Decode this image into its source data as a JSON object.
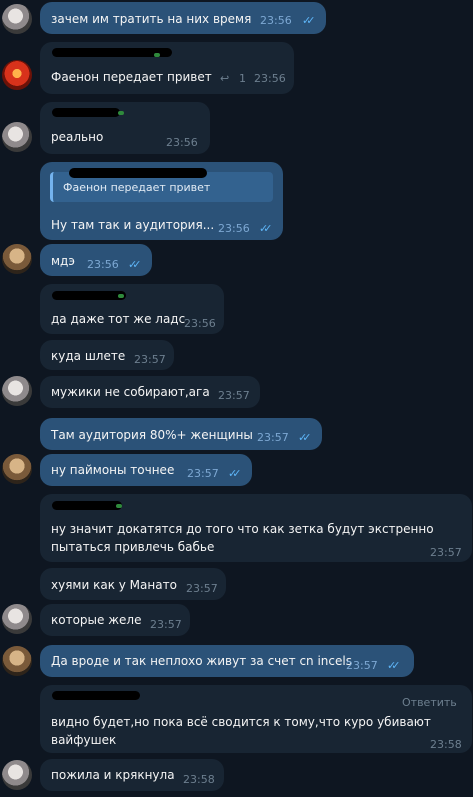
{
  "messages": [
    {
      "text": "зачем им тратить на них время",
      "time": "23:56"
    },
    {
      "text": "Фаенон передает привет",
      "time": "23:56",
      "reply_count": "1"
    },
    {
      "text": "реально",
      "time": "23:56"
    },
    {
      "reply_quote": "Фаенон передает привет",
      "text": "Ну там так и аудитория...",
      "time": "23:56"
    },
    {
      "text": "мдэ",
      "time": "23:56"
    },
    {
      "text": "да даже тот же ладс",
      "time": "23:56"
    },
    {
      "text": "куда шлете",
      "time": "23:57"
    },
    {
      "text": "мужики не собирают,ага",
      "time": "23:57"
    },
    {
      "text": "Там аудитория 80%+ женщины",
      "time": "23:57"
    },
    {
      "text": "ну паймоны точнее",
      "time": "23:57"
    },
    {
      "text_line1": "ну значит докатятся до того что как зетка будут экстренно",
      "text_line2": "пытаться привлечь бабье",
      "time": "23:57"
    },
    {
      "text": "хуями как у Манато",
      "time": "23:57"
    },
    {
      "text": "которые желе",
      "time": "23:57"
    },
    {
      "text": "Да вроде и так неплохо живут за счет cn incels",
      "time": "23:57"
    },
    {
      "text_line1": "видно будет,но пока всё сводится к тому,что куро убивают",
      "text_line2": "вайфушек",
      "time": "23:58",
      "action": "Ответить"
    },
    {
      "text": "пожила и крякнула",
      "time": "23:58"
    }
  ],
  "icons": {
    "read_check": "double-check-icon",
    "reply_arrow": "reply-arrow-icon"
  },
  "colors": {
    "background": "#0e1621",
    "incoming": "#182533",
    "outgoing": "#2b5278",
    "accent": "#5eb5f7"
  }
}
